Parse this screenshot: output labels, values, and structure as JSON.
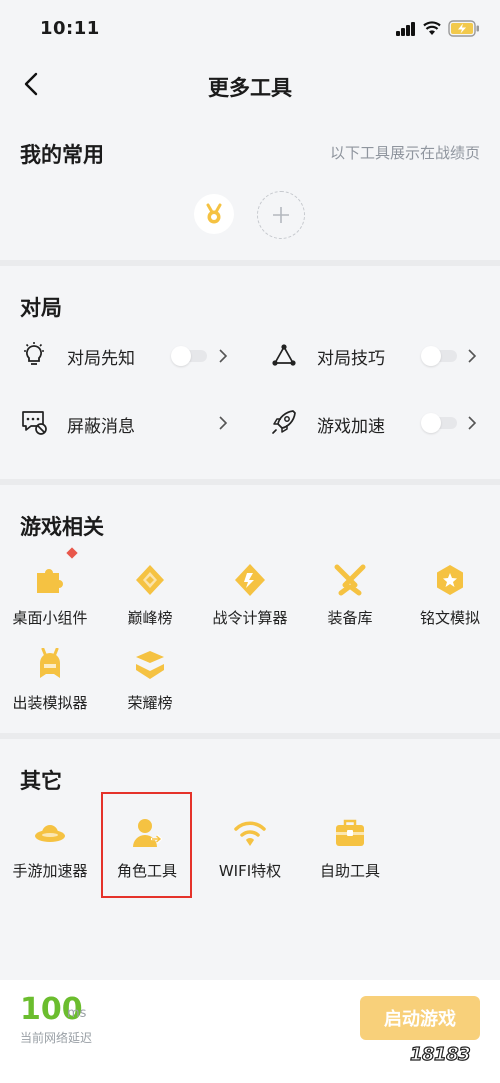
{
  "status_bar": {
    "time": "10:11"
  },
  "header": {
    "title": "更多工具"
  },
  "favorites": {
    "title": "我的常用",
    "hint": "以下工具展示在战绩页"
  },
  "match": {
    "title": "对局",
    "items": [
      {
        "label": "对局先知",
        "icon": "bulb-icon",
        "has_toggle": true
      },
      {
        "label": "对局技巧",
        "icon": "triangle-nodes-icon",
        "has_toggle": true
      },
      {
        "label": "屏蔽消息",
        "icon": "block-message-icon",
        "has_toggle": false
      },
      {
        "label": "游戏加速",
        "icon": "rocket-icon",
        "has_toggle": true
      }
    ]
  },
  "game": {
    "title": "游戏相关",
    "items": [
      {
        "label": "桌面小组件",
        "icon": "puzzle-icon",
        "dot": true
      },
      {
        "label": "巅峰榜",
        "icon": "peak-icon"
      },
      {
        "label": "战令计算器",
        "icon": "pass-calculator-icon"
      },
      {
        "label": "装备库",
        "icon": "crossed-swords-icon"
      },
      {
        "label": "铭文模拟",
        "icon": "hexagon-star-icon"
      },
      {
        "label": "出装模拟器",
        "icon": "helmet-icon"
      },
      {
        "label": "荣耀榜",
        "icon": "glory-icon"
      }
    ]
  },
  "other": {
    "title": "其它",
    "items": [
      {
        "label": "手游加速器",
        "icon": "ufo-icon"
      },
      {
        "label": "角色工具",
        "icon": "user-arrow-icon"
      },
      {
        "label": "WIFI特权",
        "icon": "wifi-shield-icon"
      },
      {
        "label": "自助工具",
        "icon": "toolbox-icon"
      }
    ]
  },
  "footer": {
    "ping_value": "100",
    "ping_unit": "ms",
    "ping_label": "当前网络延迟",
    "start_label": "启动游戏"
  },
  "watermark": "18183",
  "colors": {
    "accent": "#f5c242",
    "ping": "#6bbd2e",
    "highlight": "#e5322a",
    "button": "#f8d07a"
  }
}
